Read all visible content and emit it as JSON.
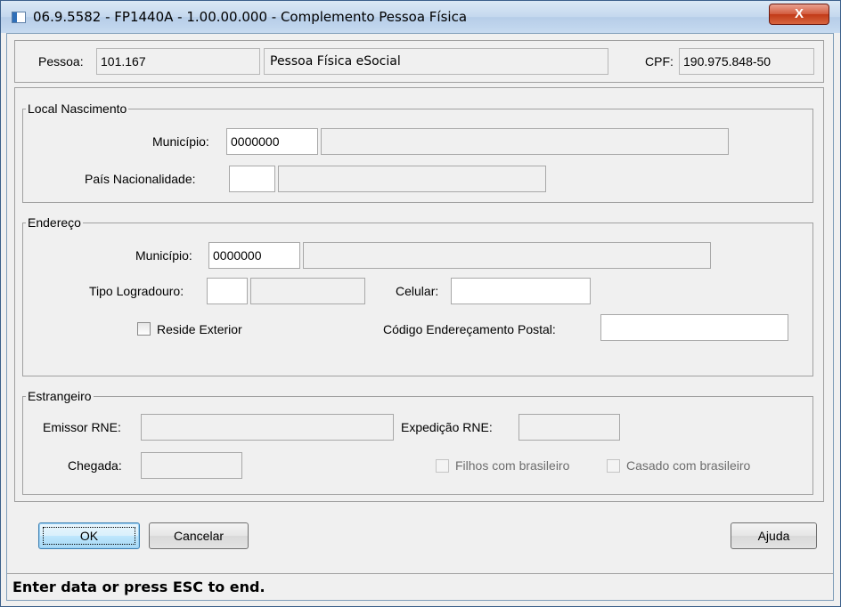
{
  "window": {
    "title": "06.9.5582 - FP1440A - 1.00.00.000 - Complemento Pessoa Física",
    "close_glyph": "X"
  },
  "pessoa": {
    "label": "Pessoa:",
    "code": "101.167",
    "name": "Pessoa Física eSocial",
    "cpf_label": "CPF:",
    "cpf": "190.975.848-50"
  },
  "local_nascimento": {
    "title": "Local Nascimento",
    "municipio_label": "Município:",
    "municipio_code": "0000000",
    "municipio_name": "",
    "pais_label": "País Nacionalidade:",
    "pais_code": "",
    "pais_name": ""
  },
  "endereco": {
    "title": "Endereço",
    "municipio_label": "Município:",
    "municipio_code": "0000000",
    "municipio_name": "",
    "tipo_logradouro_label": "Tipo Logradouro:",
    "tipo_logradouro_code": "",
    "tipo_logradouro_desc": "",
    "celular_label": "Celular:",
    "celular": "",
    "reside_exterior_label": "Reside Exterior",
    "reside_exterior_checked": false,
    "cep_label": "Código Endereçamento Postal:",
    "cep": ""
  },
  "estrangeiro": {
    "title": "Estrangeiro",
    "emissor_rne_label": "Emissor RNE:",
    "emissor_rne": "",
    "expedicao_rne_label": "Expedição RNE:",
    "expedicao_rne": "",
    "chegada_label": "Chegada:",
    "chegada": "",
    "filhos_label": "Filhos com brasileiro",
    "filhos_checked": false,
    "casado_label": "Casado com brasileiro",
    "casado_checked": false
  },
  "buttons": {
    "ok": "OK",
    "cancel": "Cancelar",
    "help": "Ajuda"
  },
  "status": {
    "text": "Enter data or press ESC to end."
  }
}
